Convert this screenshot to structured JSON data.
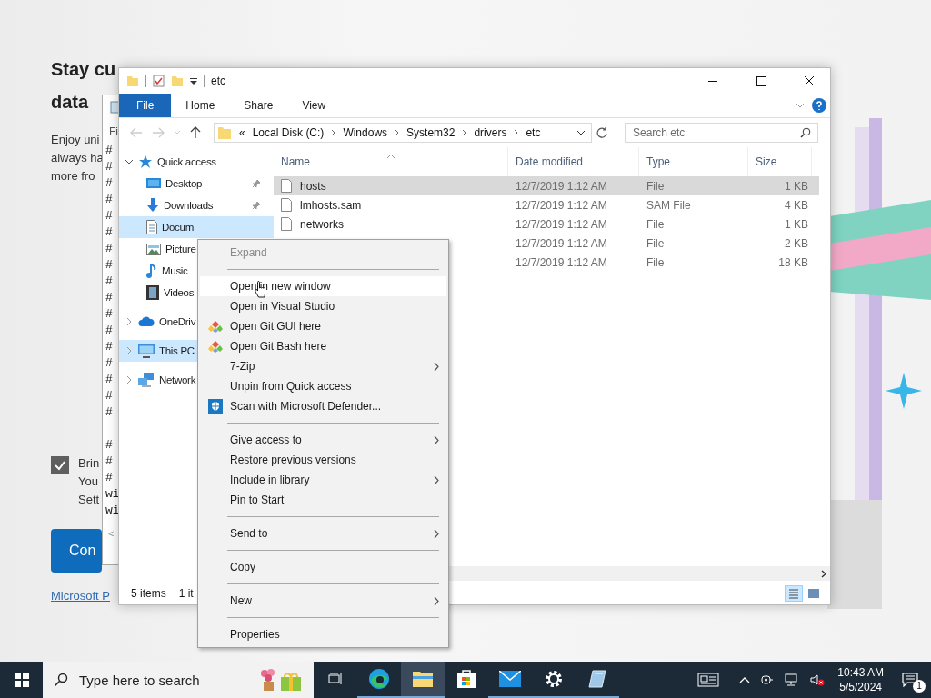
{
  "background_page": {
    "title_lines": [
      "Stay cu",
      "data"
    ],
    "body_lines": [
      "Enjoy uni",
      "always ha",
      "more fro"
    ],
    "checkbox": {
      "checked": true,
      "lines": [
        "Brin",
        "You",
        "Sett"
      ]
    },
    "button": "Con",
    "link": "Microsoft P"
  },
  "notepad": {
    "menu": "Fi",
    "lines_top": [
      "#",
      "#",
      "#",
      "#",
      "#",
      "#",
      "#",
      "#",
      "#",
      "#",
      "#",
      "#",
      "#",
      "#",
      "#",
      "#",
      "#"
    ],
    "lines_bottom": [
      "#",
      "#",
      "#",
      "wi",
      "wi"
    ],
    "scroll_left": "<"
  },
  "explorer": {
    "title": "etc",
    "tabs": [
      {
        "label": "File",
        "selected": true
      },
      {
        "label": "Home",
        "selected": false
      },
      {
        "label": "Share",
        "selected": false
      },
      {
        "label": "View",
        "selected": false
      }
    ],
    "address": {
      "overflow": "«",
      "segments": [
        "Local Disk (C:)",
        "Windows",
        "System32",
        "drivers",
        "etc"
      ]
    },
    "search": {
      "placeholder": "Search etc"
    },
    "nav": [
      {
        "label": "Quick access",
        "kind": "star",
        "expanded": true,
        "selected": false,
        "children": [
          {
            "label": "Desktop",
            "kind": "desktop",
            "pinned": true,
            "selected": false
          },
          {
            "label": "Downloads",
            "kind": "downloads",
            "pinned": true,
            "selected": false
          },
          {
            "label": "Docum",
            "kind": "documents",
            "pinned": false,
            "selected": true
          },
          {
            "label": "Picture",
            "kind": "pictures",
            "pinned": false,
            "selected": false
          },
          {
            "label": "Music",
            "kind": "music",
            "pinned": false,
            "selected": false
          },
          {
            "label": "Videos",
            "kind": "videos",
            "pinned": false,
            "selected": false
          }
        ]
      },
      {
        "label": "OneDriv",
        "kind": "cloud",
        "expanded": false,
        "selected": false
      },
      {
        "label": "This PC",
        "kind": "pc",
        "expanded": false,
        "selected": true
      },
      {
        "label": "Network",
        "kind": "network",
        "expanded": false,
        "selected": false
      }
    ],
    "columns": [
      "Name",
      "Date modified",
      "Type",
      "Size"
    ],
    "rows": [
      {
        "name": "hosts",
        "date": "12/7/2019 1:12 AM",
        "type": "File",
        "size": "1 KB",
        "selected": true
      },
      {
        "name": "lmhosts.sam",
        "date": "12/7/2019 1:12 AM",
        "type": "SAM File",
        "size": "4 KB",
        "selected": false
      },
      {
        "name": "networks",
        "date": "12/7/2019 1:12 AM",
        "type": "File",
        "size": "1 KB",
        "selected": false
      },
      {
        "date": "12/7/2019 1:12 AM",
        "type": "File",
        "size": "2 KB",
        "selected": false
      },
      {
        "date": "12/7/2019 1:12 AM",
        "type": "File",
        "size": "18 KB",
        "selected": false
      }
    ],
    "status": {
      "count": "5 items",
      "selection": "1 it"
    },
    "views": [
      {
        "kind": "details",
        "selected": true
      },
      {
        "kind": "tiles",
        "selected": false
      }
    ]
  },
  "context_menu": [
    {
      "kind": "item",
      "label": "Expand",
      "disabled": true,
      "highlighted": false,
      "submenu": false
    },
    {
      "kind": "separator"
    },
    {
      "kind": "item",
      "label": "Open in new window",
      "disabled": false,
      "highlighted": true,
      "submenu": false
    },
    {
      "kind": "item",
      "label": "Open in Visual Studio",
      "disabled": false,
      "highlighted": false,
      "submenu": false
    },
    {
      "kind": "git",
      "label": "Open Git GUI here",
      "disabled": false,
      "highlighted": false,
      "submenu": false
    },
    {
      "kind": "git",
      "label": "Open Git Bash here",
      "disabled": false,
      "highlighted": false,
      "submenu": false
    },
    {
      "kind": "item",
      "label": "7-Zip",
      "disabled": false,
      "highlighted": false,
      "submenu": true
    },
    {
      "kind": "item",
      "label": "Unpin from Quick access",
      "disabled": false,
      "highlighted": false,
      "submenu": false
    },
    {
      "kind": "defender",
      "label": "Scan with Microsoft Defender...",
      "disabled": false,
      "highlighted": false,
      "submenu": false
    },
    {
      "kind": "separator"
    },
    {
      "kind": "item",
      "label": "Give access to",
      "disabled": false,
      "highlighted": false,
      "submenu": true
    },
    {
      "kind": "item",
      "label": "Restore previous versions",
      "disabled": false,
      "highlighted": false,
      "submenu": false
    },
    {
      "kind": "item",
      "label": "Include in library",
      "disabled": false,
      "highlighted": false,
      "submenu": true
    },
    {
      "kind": "item",
      "label": "Pin to Start",
      "disabled": false,
      "highlighted": false,
      "submenu": false
    },
    {
      "kind": "separator"
    },
    {
      "kind": "item",
      "label": "Send to",
      "disabled": false,
      "highlighted": false,
      "submenu": true
    },
    {
      "kind": "separator"
    },
    {
      "kind": "item",
      "label": "Copy",
      "disabled": false,
      "highlighted": false,
      "submenu": false
    },
    {
      "kind": "separator"
    },
    {
      "kind": "item",
      "label": "New",
      "disabled": false,
      "highlighted": false,
      "submenu": true
    },
    {
      "kind": "separator"
    },
    {
      "kind": "item",
      "label": "Properties",
      "disabled": false,
      "highlighted": false,
      "submenu": false
    }
  ],
  "taskbar": {
    "search": {
      "placeholder": "Type here to search"
    },
    "apps": [
      {
        "kind": "taskview",
        "active": false,
        "running": false
      },
      {
        "kind": "edge",
        "active": false,
        "running": true
      },
      {
        "kind": "explorer",
        "active": true,
        "running": true
      },
      {
        "kind": "store",
        "active": false,
        "running": false
      },
      {
        "kind": "mail",
        "active": false,
        "running": true
      },
      {
        "kind": "settings",
        "active": false,
        "running": true
      },
      {
        "kind": "notes",
        "active": false,
        "running": true
      }
    ],
    "clock": {
      "time": "10:43 AM",
      "date": "5/5/2024"
    },
    "notifications": "1"
  }
}
